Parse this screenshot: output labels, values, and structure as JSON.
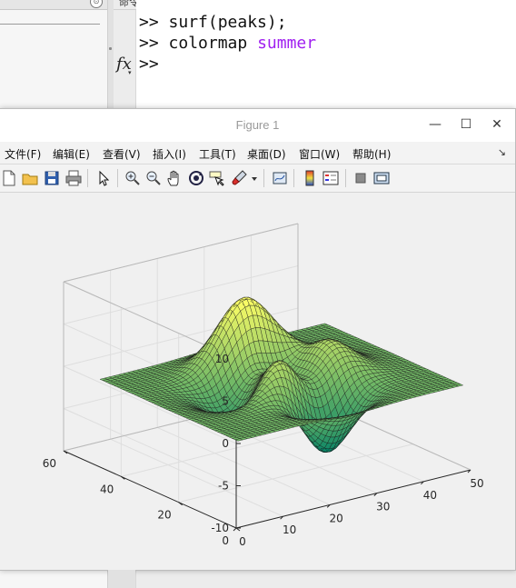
{
  "desktop": {
    "command_window_title": "命令行窗口",
    "commands": [
      {
        "prompt": ">> ",
        "text": "surf(peaks);",
        "arg": ""
      },
      {
        "prompt": ">> ",
        "text": "colormap ",
        "arg": "summer"
      },
      {
        "prompt": ">>",
        "text": "",
        "arg": ""
      }
    ],
    "fx_label": "fx",
    "arg_color": "#a020f0"
  },
  "figure": {
    "title": "Figure 1",
    "window_buttons": {
      "minimize": "—",
      "maximize": "☐",
      "close": "✕"
    },
    "menu": [
      "文件(F)",
      "编辑(E)",
      "查看(V)",
      "插入(I)",
      "工具(T)",
      "桌面(D)",
      "窗口(W)",
      "帮助(H)"
    ],
    "menu_overflow": "↘",
    "toolbar": [
      "new-figure-icon",
      "open-file-icon",
      "save-icon",
      "print-icon",
      "edit-plot-arrow-icon",
      "zoom-in-icon",
      "zoom-out-icon",
      "pan-hand-icon",
      "rotate-3d-icon",
      "data-cursor-icon",
      "brush-icon",
      "brush-dropdown-icon",
      "link-plot-icon",
      "insert-colorbar-icon",
      "insert-legend-icon",
      "hide-plot-tools-icon",
      "show-plot-tools-icon"
    ]
  },
  "chart_data": {
    "type": "surface",
    "function": "peaks",
    "colormap": "summer",
    "grid": true,
    "zlim": [
      -10,
      10
    ],
    "xlim": [
      0,
      50
    ],
    "ylim": [
      0,
      60
    ],
    "zticks": [
      "10",
      "5",
      "0",
      "-5",
      "-10"
    ],
    "xticks": [
      "0",
      "10",
      "20",
      "30",
      "40",
      "50"
    ],
    "yticks": [
      "0",
      "20",
      "40",
      "60"
    ],
    "title": "",
    "xlabel": "",
    "ylabel": "",
    "zlabel": ""
  }
}
